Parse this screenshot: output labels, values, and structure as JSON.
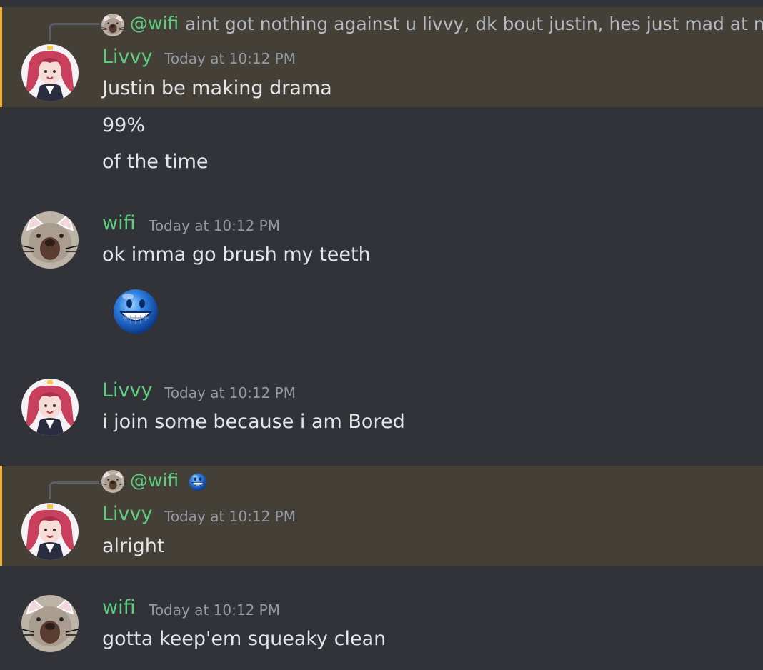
{
  "messages": [
    {
      "reply": {
        "name": "@wifi",
        "text": "aint got nothing against u livvy, dk bout justin, hes just mad at me"
      },
      "author": "Livvy",
      "timestamp": "Today at 10:12 PM",
      "lines": [
        "Justin be making drama",
        "99%",
        "of the time"
      ]
    },
    {
      "author": "wifi",
      "timestamp": "Today at 10:12 PM",
      "lines": [
        "ok imma go brush my teeth"
      ],
      "emoji": "grinning-blue-face-emoji"
    },
    {
      "author": "Livvy",
      "timestamp": "Today at 10:12 PM",
      "lines": [
        "i join some because i am Bored"
      ]
    },
    {
      "reply": {
        "name": "@wifi",
        "emoji": "grinning-blue-face-emoji"
      },
      "author": "Livvy",
      "timestamp": "Today at 10:12 PM",
      "lines": [
        "alright"
      ]
    },
    {
      "author": "wifi",
      "timestamp": "Today at 10:12 PM",
      "lines": [
        "gotta keep'em squeaky clean"
      ]
    }
  ],
  "colors": {
    "background": "#313338",
    "mention_highlight": "#444038",
    "mention_bar": "#f0b232",
    "username": "#5ecb7f",
    "timestamp": "#949ba4",
    "text": "#e3e5e8"
  }
}
